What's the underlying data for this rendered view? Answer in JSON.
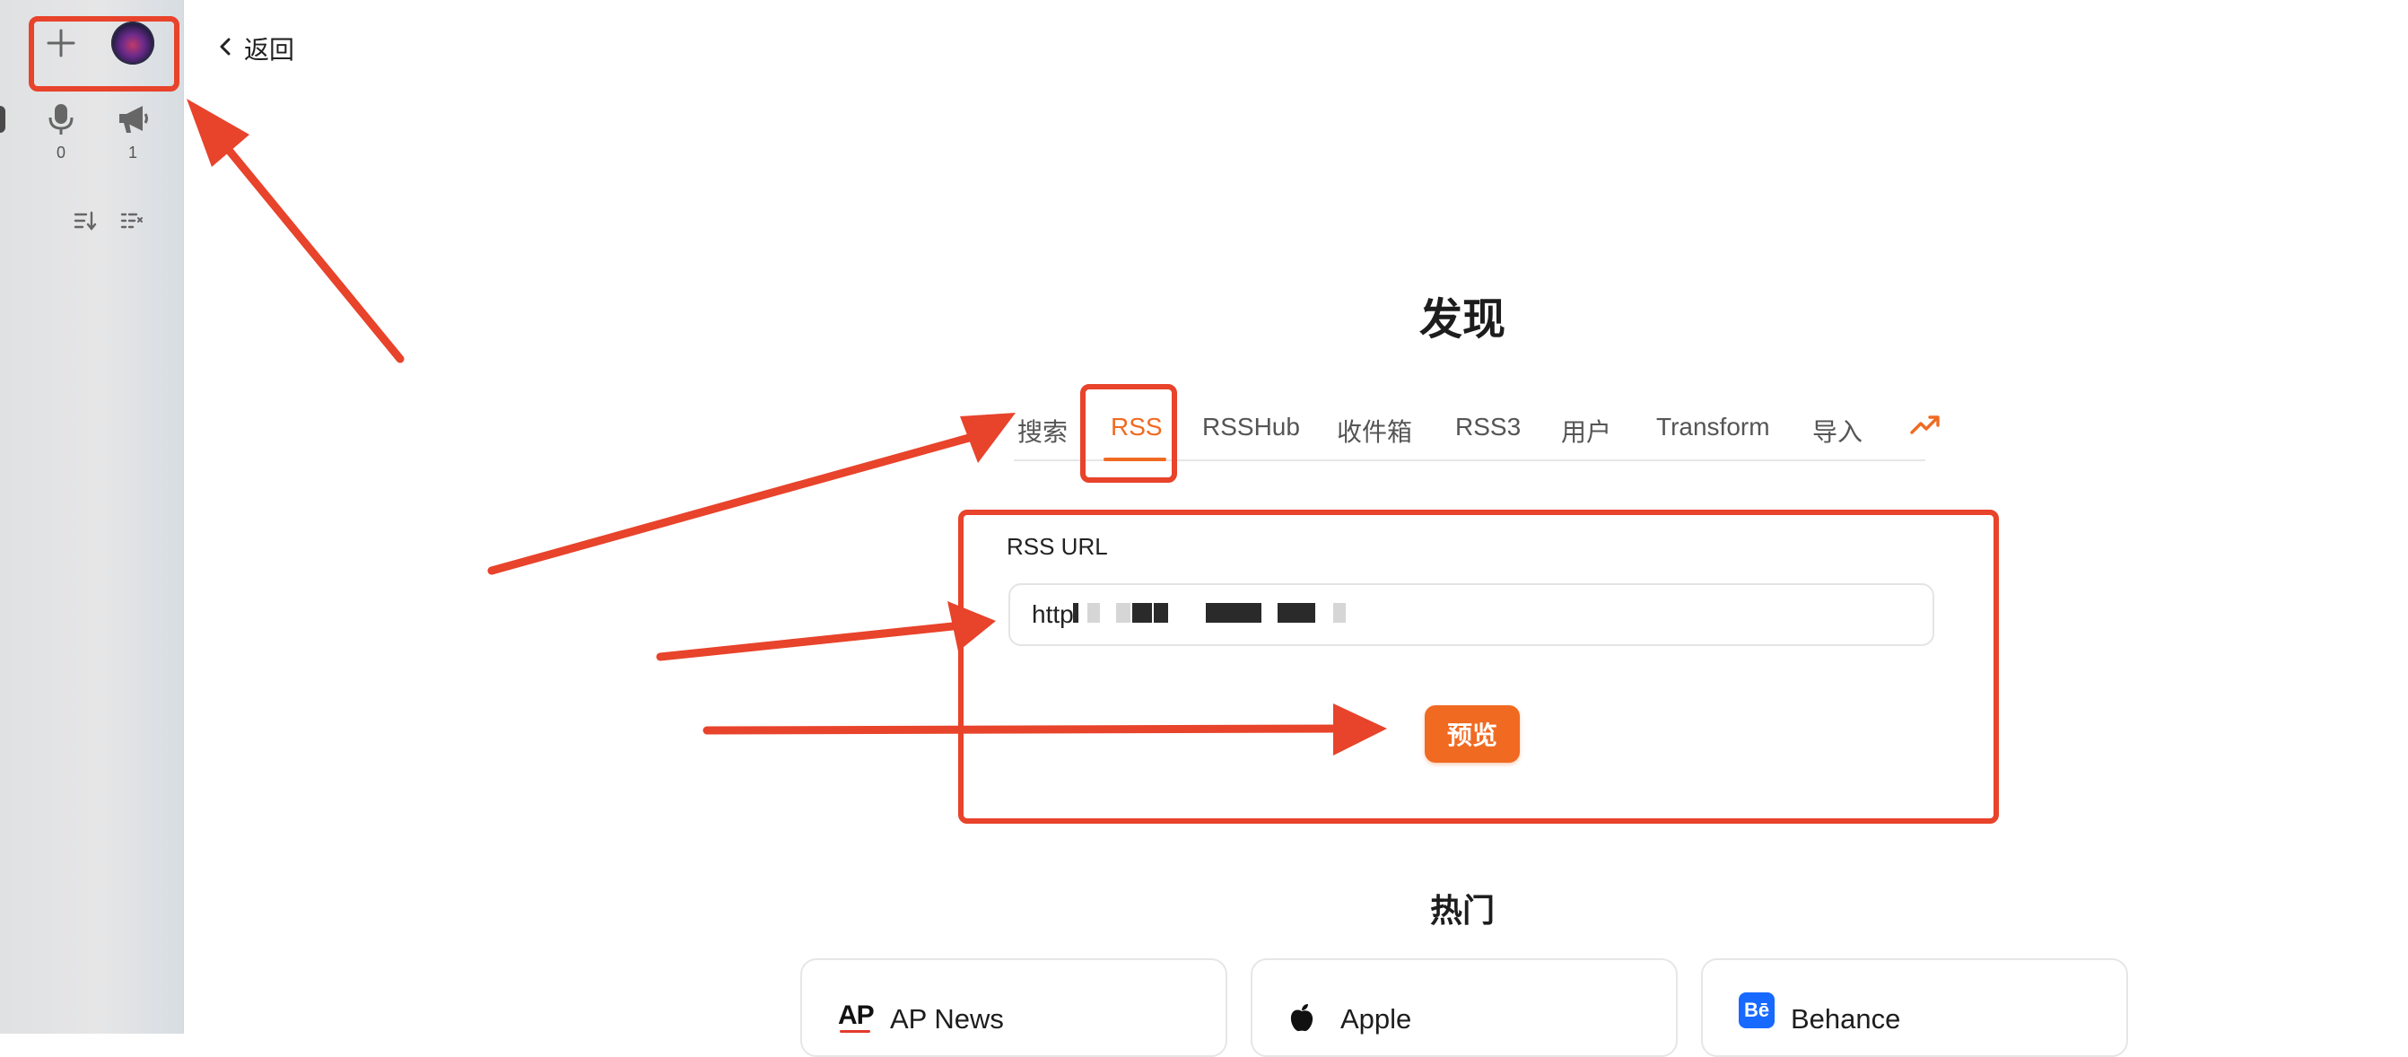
{
  "sidebar": {
    "add_icon": "plus-icon",
    "avatar": "user-avatar",
    "stats": [
      {
        "icon": "microphone-icon",
        "count": "0"
      },
      {
        "icon": "megaphone-icon",
        "count": "1"
      }
    ],
    "actions": [
      "sort-icon",
      "list-filter-icon"
    ]
  },
  "header": {
    "back_label": "返回"
  },
  "page": {
    "title": "发现"
  },
  "tabs": [
    {
      "label": "搜索",
      "active": false
    },
    {
      "label": "RSS",
      "active": true
    },
    {
      "label": "RSSHub",
      "active": false
    },
    {
      "label": "收件箱",
      "active": false
    },
    {
      "label": "RSS3",
      "active": false
    },
    {
      "label": "用户",
      "active": false
    },
    {
      "label": "Transform",
      "active": false
    },
    {
      "label": "导入",
      "active": false
    }
  ],
  "trending_icon": "trending-up-icon",
  "form": {
    "label": "RSS URL",
    "value": "http",
    "submit": "预览"
  },
  "popular": {
    "title": "热门",
    "cards": [
      {
        "logo": "AP",
        "name": "AP News"
      },
      {
        "logo": "apple-icon",
        "name": "Apple"
      },
      {
        "logo": "Bē",
        "name": "Behance"
      }
    ]
  },
  "colors": {
    "accent": "#f06a22",
    "annotation": "#e8432b",
    "sidebar_bg": "#e3e5e6"
  }
}
